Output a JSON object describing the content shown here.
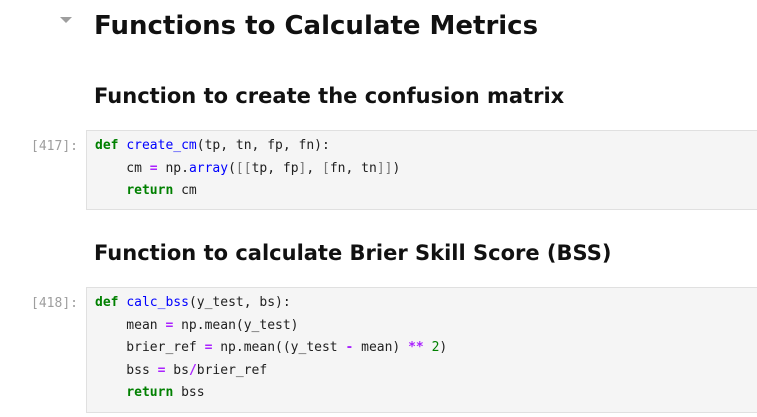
{
  "section": {
    "title": "Functions to Calculate Metrics"
  },
  "cells": [
    {
      "heading": "Function to create the confusion matrix",
      "prompt": "[417]:",
      "lines": [
        [
          [
            "kw",
            "def"
          ],
          [
            "plain",
            " "
          ],
          [
            "fn",
            "create_cm"
          ],
          [
            "plain",
            "(tp, tn, fp, fn):"
          ]
        ],
        [
          [
            "plain",
            "    cm "
          ],
          [
            "op",
            "="
          ],
          [
            "plain",
            " np."
          ],
          [
            "fn",
            "array"
          ],
          [
            "plain",
            "("
          ],
          [
            "br",
            "[["
          ],
          [
            "plain",
            "tp, fp"
          ],
          [
            "br",
            "]"
          ],
          [
            "plain",
            ", "
          ],
          [
            "br",
            "["
          ],
          [
            "plain",
            "fn, tn"
          ],
          [
            "br",
            "]]"
          ],
          [
            "plain",
            ")"
          ]
        ],
        [
          [
            "plain",
            "    "
          ],
          [
            "kw",
            "return"
          ],
          [
            "plain",
            " cm"
          ]
        ]
      ]
    },
    {
      "heading": "Function to calculate Brier Skill Score (BSS)",
      "prompt": "[418]:",
      "lines": [
        [
          [
            "kw",
            "def"
          ],
          [
            "plain",
            " "
          ],
          [
            "fn",
            "calc_bss"
          ],
          [
            "plain",
            "(y_test, bs):"
          ]
        ],
        [
          [
            "plain",
            "    mean "
          ],
          [
            "op",
            "="
          ],
          [
            "plain",
            " np."
          ],
          [
            "plain",
            "mean(y_test)"
          ]
        ],
        [
          [
            "plain",
            "    brier_ref "
          ],
          [
            "op",
            "="
          ],
          [
            "plain",
            " np."
          ],
          [
            "plain",
            "mean((y_test "
          ],
          [
            "op",
            "-"
          ],
          [
            "plain",
            " mean) "
          ],
          [
            "op",
            "**"
          ],
          [
            "plain",
            " "
          ],
          [
            "num",
            "2"
          ],
          [
            "plain",
            ")"
          ]
        ],
        [
          [
            "plain",
            "    bss "
          ],
          [
            "op",
            "="
          ],
          [
            "plain",
            " bs"
          ],
          [
            "op",
            "/"
          ],
          [
            "plain",
            "brier_ref"
          ]
        ],
        [
          [
            "plain",
            "    "
          ],
          [
            "kw",
            "return"
          ],
          [
            "plain",
            " bss"
          ]
        ]
      ]
    }
  ]
}
